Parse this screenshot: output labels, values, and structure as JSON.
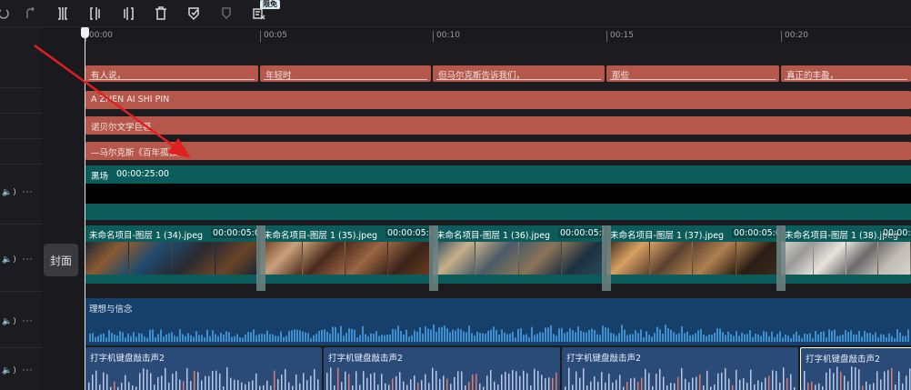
{
  "toolbar": {
    "icons": [
      "redo-left-icon",
      "redo-icon",
      "split-icon",
      "split-left-icon",
      "split-right-icon",
      "delete-icon",
      "shield-mark-icon",
      "shield-icon",
      "export-icon"
    ],
    "badge": "限免"
  },
  "ruler": {
    "ticks": [
      "00:00",
      "00:05",
      "00:10",
      "00:15",
      "00:20"
    ]
  },
  "cover_label": "封面",
  "subtitle_clips": [
    {
      "text": "有人说，"
    },
    {
      "text": "年轻时"
    },
    {
      "text": "但马尔克斯告诉我们，"
    },
    {
      "text": "那些"
    },
    {
      "text": "真正的丰盈，"
    }
  ],
  "text_tracks": [
    {
      "text": "A ZHEN AI SHI PIN"
    },
    {
      "text": "诺贝尔文学巨著"
    },
    {
      "text": "—马尔克斯《百年孤独》"
    }
  ],
  "black_clip": {
    "name": "黑场",
    "duration": "00:00:25:00"
  },
  "video_clips": [
    {
      "name": "未命名项目-图层 1 (34).jpeg",
      "duration": "00:00:05:00",
      "palette": [
        "#1c2630",
        "#8a5a32",
        "#1e4a6e",
        "#2a2a30",
        "#6a4428"
      ]
    },
    {
      "name": "未命名项目-图层 1 (35).jpeg",
      "duration": "00:00:05:00",
      "palette": [
        "#6b3a22",
        "#c8a07a",
        "#4a2a1c",
        "#9a6644",
        "#3a2418"
      ]
    },
    {
      "name": "未命名项目-图层 1 (36).jpeg",
      "duration": "00:00:05:00",
      "palette": [
        "#2a4a5a",
        "#c8b08a",
        "#4a5a66",
        "#8a7458",
        "#1e3040"
      ]
    },
    {
      "name": "未命名项目-图层 1 (37).jpeg",
      "duration": "00:00:05:00",
      "palette": [
        "#3a2a1c",
        "#d8a060",
        "#5a4030",
        "#b08050",
        "#2a1e14"
      ]
    },
    {
      "name": "未命名项目-图层 1 (38).jpeg",
      "duration": "00:00:0",
      "palette": [
        "#d8d4cc",
        "#9a9a98",
        "#e8e4dc",
        "#6a6a6a",
        "#c0bcb4"
      ]
    }
  ],
  "music_clip": {
    "name": "理想与信念"
  },
  "sfx_clips": [
    {
      "name": "打字机键盘敲击声2"
    },
    {
      "name": "打字机键盘敲击声2"
    },
    {
      "name": "打字机键盘敲击声2"
    },
    {
      "name": "打字机键盘敲击声2"
    }
  ],
  "track_controls": {
    "volume_icon": "🔈)",
    "more": "···"
  },
  "colors": {
    "text_clip": "#b5584b",
    "video_track": "#0c5c5c",
    "audio_music": "#163f6a",
    "audio_sfx": "#2a4a78",
    "arrow": "#e02020"
  }
}
